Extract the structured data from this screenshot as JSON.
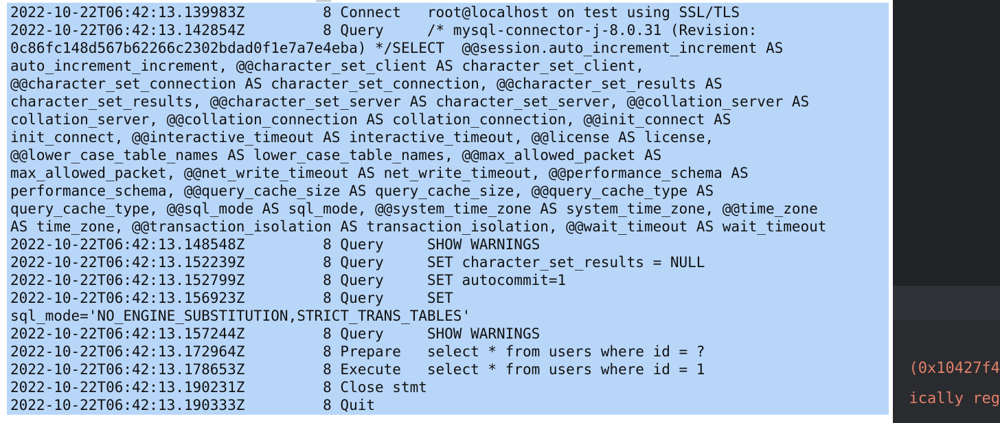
{
  "terminal": {
    "lines": [
      "2022-10-22T06:42:13.139983Z\t    8 Connect\troot@localhost on test using SSL/TLS",
      "2022-10-22T06:42:13.142854Z\t    8 Query\t/* mysql-connector-j-8.0.31 (Revision:",
      "0c86fc148d567b62266c2302bdad0f1e7a7e4eba) */SELECT  @@session.auto_increment_increment AS",
      "auto_increment_increment, @@character_set_client AS character_set_client,",
      "@@character_set_connection AS character_set_connection, @@character_set_results AS",
      "character_set_results, @@character_set_server AS character_set_server, @@collation_server AS",
      "collation_server, @@collation_connection AS collation_connection, @@init_connect AS",
      "init_connect, @@interactive_timeout AS interactive_timeout, @@license AS license,",
      "@@lower_case_table_names AS lower_case_table_names, @@max_allowed_packet AS",
      "max_allowed_packet, @@net_write_timeout AS net_write_timeout, @@performance_schema AS",
      "performance_schema, @@query_cache_size AS query_cache_size, @@query_cache_type AS",
      "query_cache_type, @@sql_mode AS sql_mode, @@system_time_zone AS system_time_zone, @@time_zone",
      "AS time_zone, @@transaction_isolation AS transaction_isolation, @@wait_timeout AS wait_timeout",
      "2022-10-22T06:42:13.148548Z\t    8 Query\tSHOW WARNINGS",
      "2022-10-22T06:42:13.152239Z\t    8 Query\tSET character_set_results = NULL",
      "2022-10-22T06:42:13.152799Z\t    8 Query\tSET autocommit=1",
      "2022-10-22T06:42:13.156923Z\t    8 Query\tSET",
      "sql_mode='NO_ENGINE_SUBSTITUTION,STRICT_TRANS_TABLES'",
      "2022-10-22T06:42:13.157244Z\t    8 Query\tSHOW WARNINGS",
      "2022-10-22T06:42:13.172964Z\t    8 Prepare\tselect * from users where id = ?",
      "2022-10-22T06:42:13.178653Z\t    8 Execute\tselect * from users where id = 1",
      "2022-10-22T06:42:13.190231Z\t    8 Close stmt\t",
      "2022-10-22T06:42:13.190333Z\t    8 Quit\t"
    ],
    "selection_color": "#b8d6f8"
  },
  "background_editor": {
    "line1": "(0x10427f4",
    "line2": "ically reg",
    "text_color": "#e0806a"
  }
}
